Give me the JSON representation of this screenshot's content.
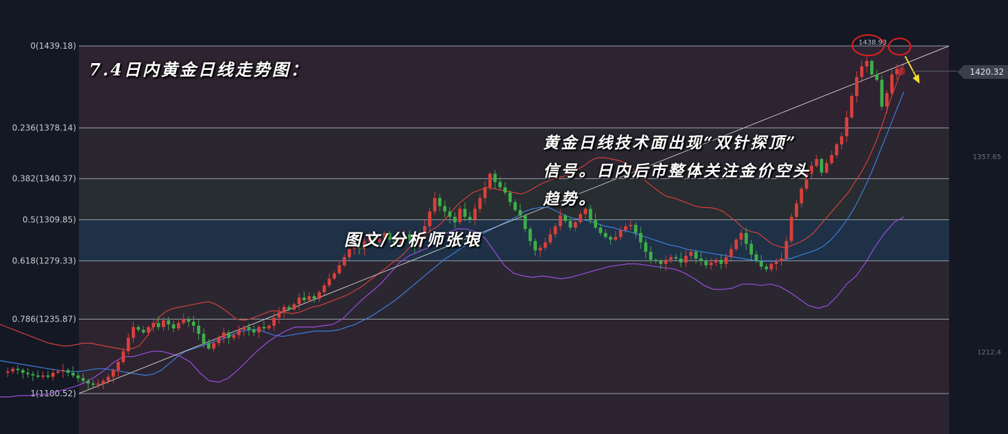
{
  "texts": {
    "title": "7.4日内黄金日线走势图：",
    "note_lines": [
      "黄金日线技术面出现“双针探顶”",
      "信号。日内后市整体关注金价空头",
      "趋势。"
    ],
    "author": "图文/分析师张垠",
    "current_price": "1420.32",
    "high_annotation": "1438.93",
    "right_axis_labels": [
      "1357.65",
      "1212.4"
    ]
  },
  "colors": {
    "up_candle": "#d9403c",
    "down_candle": "#3fae4a",
    "upper_band": "#d9403c",
    "middle_band": "#3d7fe0",
    "lower_band": "#9b4fe0",
    "trendline": "#c8c8c8",
    "arrow": "#f2e030",
    "circle": "#e02020"
  },
  "chart_data": {
    "type": "candlestick",
    "title": "7.4日内黄金日线走势图：",
    "fibonacci_levels": [
      {
        "label": "0(1439.18)",
        "ratio": 0,
        "price": 1439.18
      },
      {
        "label": "0.236(1378.14)",
        "ratio": 0.236,
        "price": 1378.14
      },
      {
        "label": "0.382(1340.37)",
        "ratio": 0.382,
        "price": 1340.37
      },
      {
        "label": "0.5(1309.85)",
        "ratio": 0.5,
        "price": 1309.85
      },
      {
        "label": "0.618(1279.33)",
        "ratio": 0.618,
        "price": 1279.33
      },
      {
        "label": "0.786(1235.87)",
        "ratio": 0.786,
        "price": 1235.87
      },
      {
        "label": "1(1180.52)",
        "ratio": 1,
        "price": 1180.52
      }
    ],
    "price_path": [
      1196,
      1197,
      1199,
      1198,
      1196,
      1195,
      1194,
      1193,
      1194,
      1193,
      1196,
      1197,
      1198,
      1196,
      1194,
      1192,
      1190,
      1188,
      1187,
      1188,
      1190,
      1193,
      1198,
      1204,
      1212,
      1222,
      1230,
      1228,
      1226,
      1230,
      1233,
      1230,
      1235,
      1232,
      1229,
      1233,
      1236,
      1234,
      1231,
      1225,
      1218,
      1214,
      1218,
      1222,
      1226,
      1222,
      1224,
      1228,
      1230,
      1228,
      1226,
      1230,
      1229,
      1231,
      1237,
      1241,
      1245,
      1243,
      1247,
      1252,
      1250,
      1253,
      1251,
      1256,
      1261,
      1266,
      1270,
      1276,
      1282,
      1288,
      1292,
      1288,
      1294,
      1297,
      1293,
      1296,
      1300,
      1295,
      1292,
      1297,
      1299,
      1294,
      1290,
      1298,
      1305,
      1316,
      1326,
      1320,
      1316,
      1312,
      1308,
      1318,
      1312,
      1310,
      1318,
      1326,
      1334,
      1344,
      1338,
      1334,
      1330,
      1323,
      1317,
      1313,
      1303,
      1294,
      1287,
      1289,
      1293,
      1299,
      1305,
      1313,
      1309,
      1304,
      1308,
      1314,
      1318,
      1310,
      1304,
      1300,
      1297,
      1295,
      1297,
      1302,
      1305,
      1306,
      1300,
      1293,
      1286,
      1280,
      1279,
      1277,
      1280,
      1282,
      1281,
      1278,
      1283,
      1286,
      1281,
      1279,
      1276,
      1278,
      1280,
      1277,
      1282,
      1288,
      1295,
      1300,
      1292,
      1284,
      1279,
      1275,
      1273,
      1277,
      1279,
      1281,
      1294,
      1312,
      1322,
      1333,
      1344,
      1350,
      1355,
      1345,
      1352,
      1358,
      1366,
      1372,
      1386,
      1402,
      1416,
      1424,
      1428,
      1418,
      1414,
      1394,
      1404,
      1418,
      1422
    ],
    "bb_upper": [
      1232,
      1230,
      1228,
      1226,
      1224,
      1222,
      1220,
      1218,
      1217,
      1216,
      1216,
      1217,
      1218,
      1218,
      1217,
      1216,
      1215,
      1214,
      1213,
      1214,
      1216,
      1222,
      1230,
      1238,
      1242,
      1244,
      1245,
      1246,
      1247,
      1248,
      1249,
      1247,
      1244,
      1240,
      1236,
      1235,
      1236,
      1238,
      1240,
      1242,
      1242,
      1241,
      1240,
      1241,
      1243,
      1245,
      1246,
      1248,
      1250,
      1252,
      1254,
      1257,
      1260,
      1264,
      1268,
      1272,
      1276,
      1280,
      1284,
      1290,
      1294,
      1298,
      1302,
      1305,
      1310,
      1316,
      1322,
      1326,
      1330,
      1332,
      1334,
      1333,
      1332,
      1331,
      1330,
      1329,
      1331,
      1334,
      1337,
      1339,
      1341,
      1342,
      1344,
      1347,
      1350,
      1354,
      1356,
      1356,
      1355,
      1354,
      1352,
      1348,
      1344,
      1338,
      1334,
      1330,
      1327,
      1326,
      1324,
      1322,
      1320,
      1319,
      1319,
      1318,
      1316,
      1312,
      1308,
      1303,
      1301,
      1300,
      1296,
      1292,
      1290,
      1289,
      1291,
      1293,
      1296,
      1300,
      1306,
      1312,
      1318,
      1324,
      1330,
      1338,
      1346,
      1356,
      1368,
      1382,
      1398,
      1412,
      1426
    ],
    "bb_mid": [
      1205,
      1204,
      1203,
      1202,
      1201,
      1200,
      1199,
      1198,
      1197,
      1197,
      1197,
      1198,
      1199,
      1199,
      1198,
      1197,
      1196,
      1195,
      1194,
      1195,
      1198,
      1203,
      1208,
      1212,
      1214,
      1216,
      1218,
      1220,
      1222,
      1225,
      1227,
      1228,
      1228,
      1226,
      1224,
      1223,
      1224,
      1225,
      1226,
      1227,
      1227,
      1227,
      1228,
      1230,
      1232,
      1235,
      1238,
      1242,
      1246,
      1250,
      1255,
      1260,
      1265,
      1270,
      1275,
      1280,
      1284,
      1288,
      1292,
      1296,
      1300,
      1303,
      1306,
      1309,
      1312,
      1316,
      1318,
      1319,
      1319,
      1316,
      1313,
      1311,
      1310,
      1309,
      1307,
      1305,
      1304,
      1302,
      1301,
      1299,
      1297,
      1295,
      1293,
      1291,
      1290,
      1288,
      1287,
      1286,
      1285,
      1284,
      1283,
      1282,
      1281,
      1280,
      1279,
      1279,
      1279,
      1280,
      1281,
      1283,
      1285,
      1287,
      1290,
      1295,
      1302,
      1310,
      1320,
      1332,
      1345,
      1360,
      1375,
      1390,
      1405
    ],
    "bb_lower": [
      1178,
      1178,
      1179,
      1179,
      1180,
      1180,
      1182,
      1184,
      1186,
      1189,
      1193,
      1198,
      1204,
      1208,
      1208,
      1210,
      1212,
      1212,
      1210,
      1208,
      1204,
      1196,
      1190,
      1189,
      1192,
      1198,
      1205,
      1212,
      1218,
      1223,
      1227,
      1230,
      1230,
      1230,
      1231,
      1232,
      1236,
      1243,
      1250,
      1256,
      1262,
      1270,
      1278,
      1283,
      1286,
      1289,
      1295,
      1300,
      1303,
      1303,
      1301,
      1296,
      1286,
      1276,
      1270,
      1268,
      1267,
      1268,
      1267,
      1266,
      1267,
      1269,
      1271,
      1273,
      1275,
      1276,
      1277,
      1277,
      1276,
      1275,
      1274,
      1273,
      1270,
      1266,
      1261,
      1258,
      1258,
      1259,
      1262,
      1262,
      1261,
      1262,
      1260,
      1256,
      1251,
      1246,
      1244,
      1246,
      1253,
      1262,
      1268,
      1278,
      1290,
      1300,
      1308,
      1312
    ],
    "trendline": [
      {
        "x": 0,
        "price": 1180.52
      },
      {
        "x": 1,
        "price": 1439.18
      }
    ],
    "annotations": {
      "high": 1438.93,
      "current": 1420.32
    },
    "ylim": [
      1174,
      1450
    ]
  }
}
